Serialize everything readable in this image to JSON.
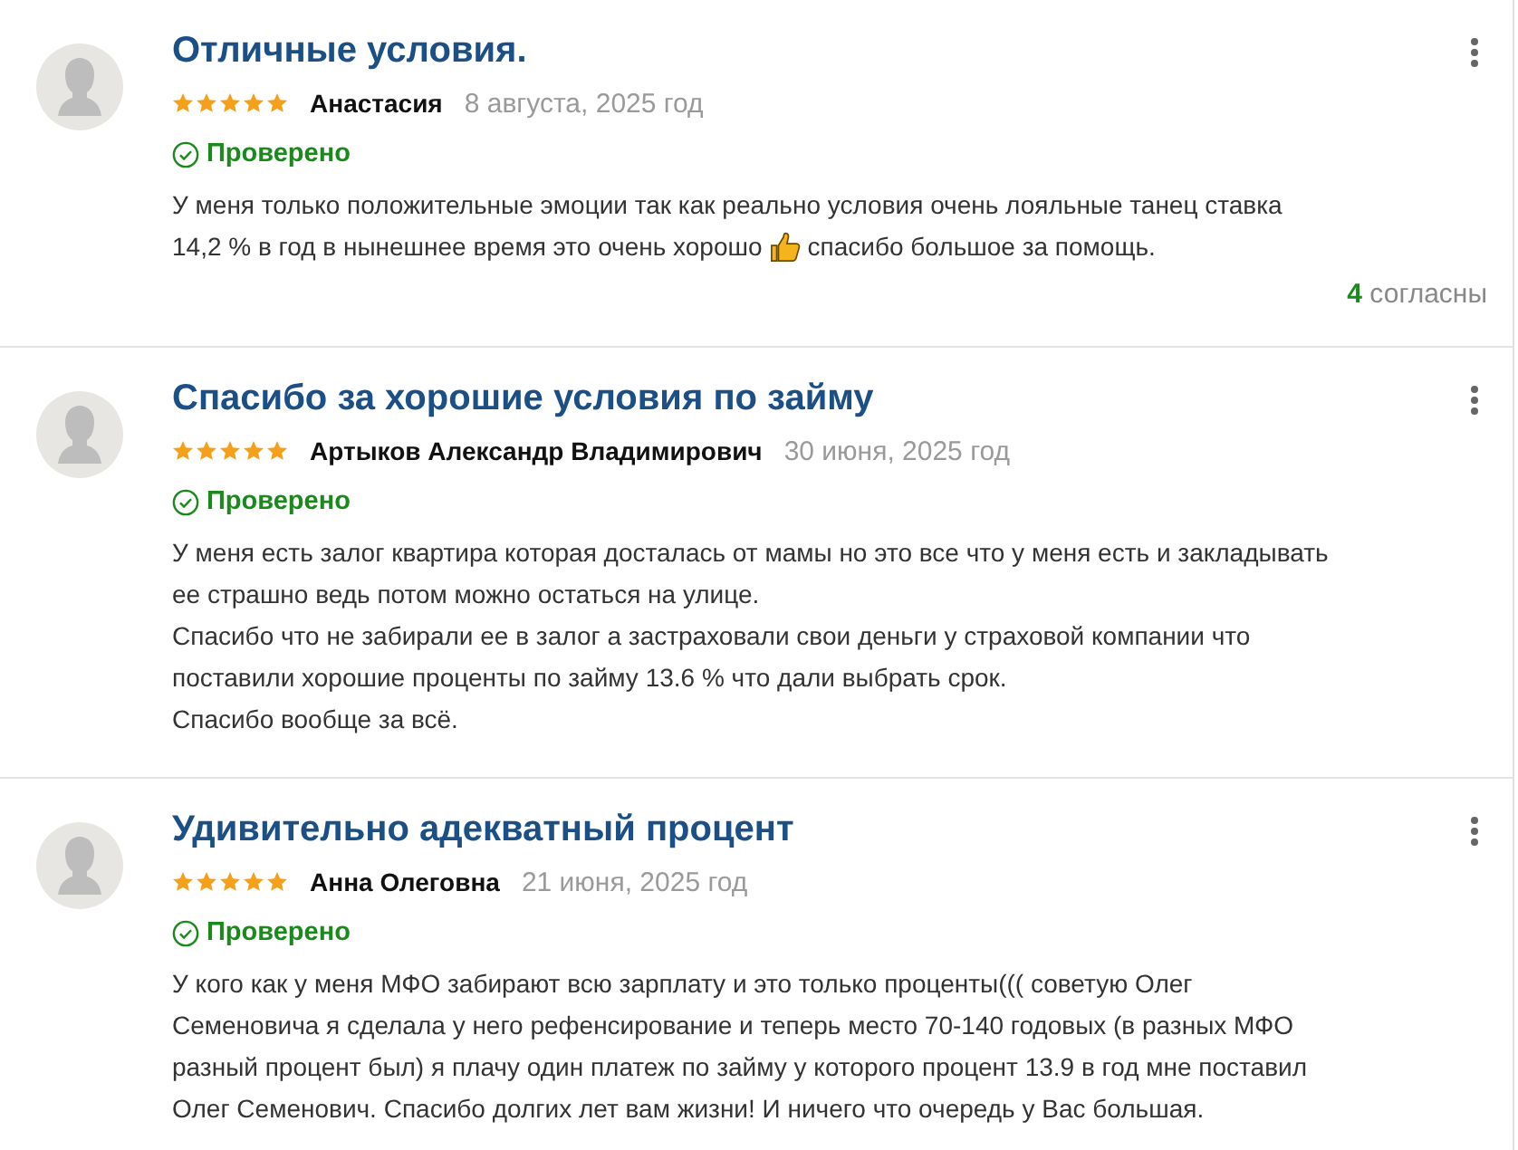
{
  "reviews": [
    {
      "title": "Отличные условия.",
      "stars": 5,
      "author": "Анастасия",
      "date": "8 августа, 2025 год",
      "verified": "Проверено",
      "body": [
        {
          "kind": "text",
          "text": "У меня только положительные эмоции так как реально условия очень лояльные танец ставка"
        },
        {
          "kind": "break"
        },
        {
          "kind": "text",
          "text": "14,2 % в год в нынешнее время это очень хорошо"
        },
        {
          "kind": "thumbs-up"
        },
        {
          "kind": "text",
          "text": "спасибо большое за помощь."
        }
      ],
      "agree": {
        "count": "4",
        "label": "согласны"
      }
    },
    {
      "title": "Спасибо за хорошие условия по займу",
      "stars": 5,
      "author": "Артыков Александр Владимирович",
      "date": "30 июня, 2025 год",
      "verified": "Проверено",
      "body": [
        {
          "kind": "text",
          "text": "У меня есть залог квартира которая досталась от мамы но это все что у меня есть и закладывать\nее страшно ведь потом можно остаться на улице.\nСпасибо что не забирали ее в залог а застраховали свои деньги у страховой компании что\nпоставили хорошие проценты по займу 13.6 % что дали выбрать срок.\nСпасибо вообще за всё."
        }
      ]
    },
    {
      "title": "Удивительно адекватный процент",
      "stars": 5,
      "author": "Анна Олеговна",
      "date": "21 июня, 2025 год",
      "verified": "Проверено",
      "body": [
        {
          "kind": "text",
          "text": "У кого как у меня МФО забирают всю зарплату и это только проценты((( советую Олег\nСеменовича я сделала у него рефенсирование и теперь место 70-140 годовых (в разных МФО\nразный процент был) я плачу один платеж по займу у которого процент 13.9 в год мне поставил\nОлег Семенович. Спасибо долгих лет вам жизни! И ничего что очередь у Вас большая."
        }
      ]
    }
  ]
}
